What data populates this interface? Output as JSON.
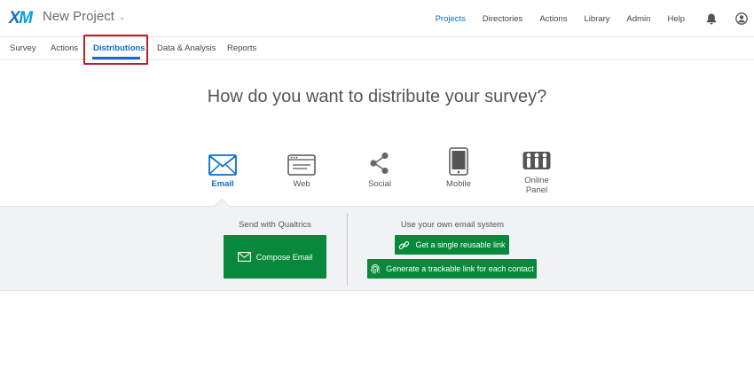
{
  "header": {
    "logo": {
      "x": "X",
      "m": "M"
    },
    "project_title": "New Project",
    "nav": [
      "Projects",
      "Directories",
      "Actions",
      "Library",
      "Admin",
      "Help"
    ],
    "active_nav": "Projects"
  },
  "tabs": [
    "Survey",
    "Actions",
    "Distributions",
    "Data & Analysis",
    "Reports"
  ],
  "active_tab": "Distributions",
  "headline": "How do you want to distribute your survey?",
  "methods": [
    {
      "label": "Email"
    },
    {
      "label": "Web"
    },
    {
      "label": "Social"
    },
    {
      "label": "Mobile"
    },
    {
      "label": "Online Panel"
    }
  ],
  "active_method": "Email",
  "email_panel": {
    "qualtrics_heading": "Send with Qualtrics",
    "compose_label": "Compose Email",
    "own_heading": "Use your own email system",
    "reusable_link_label": "Get a single reusable link",
    "trackable_link_label": "Generate a trackable link for each contact"
  },
  "colors": {
    "accent": "#0b6ed0",
    "green": "#06893a",
    "highlight": "#b5222a"
  }
}
